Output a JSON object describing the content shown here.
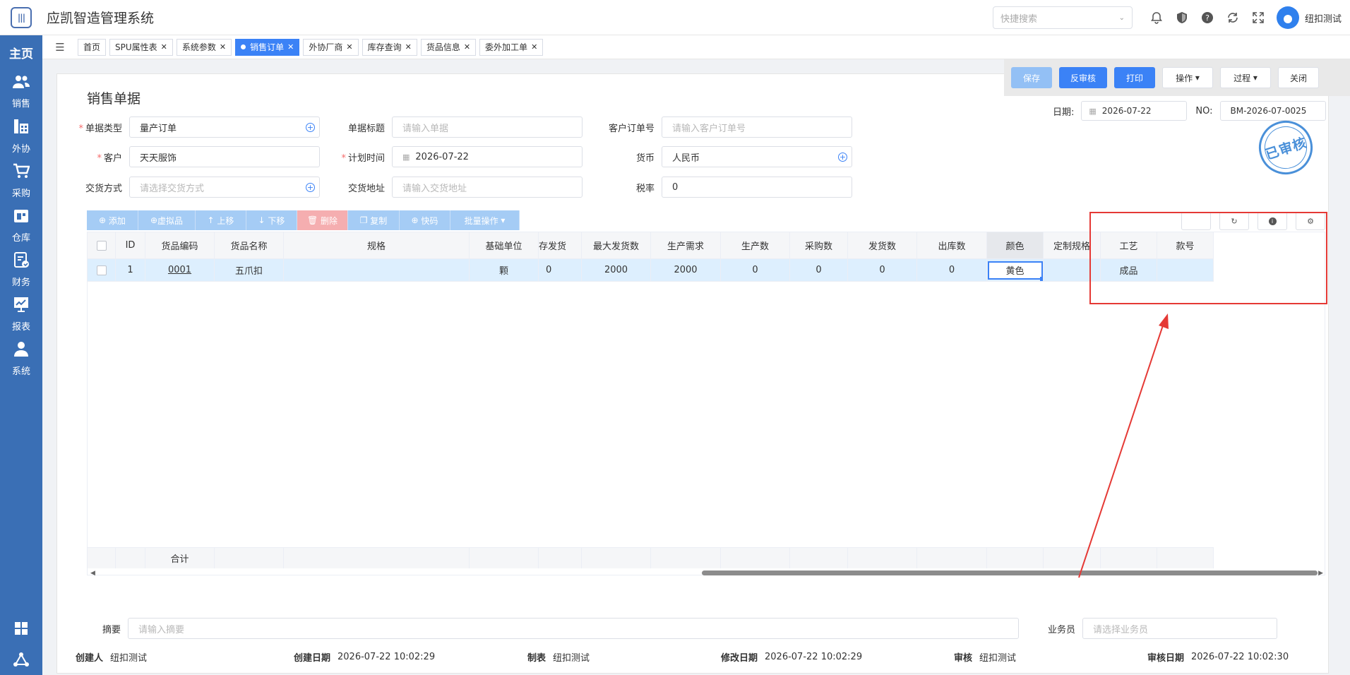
{
  "app": {
    "title": "应凯智造管理系统"
  },
  "header": {
    "search_placeholder": "快捷搜索",
    "user_name": "纽扣测试",
    "icons": [
      "bell-icon",
      "shield-icon",
      "help-icon",
      "refresh-icon",
      "fullscreen-icon"
    ]
  },
  "sidebar": {
    "home": "主页",
    "items": [
      {
        "label": "销售",
        "icon": "users-icon"
      },
      {
        "label": "外协",
        "icon": "factory-icon"
      },
      {
        "label": "采购",
        "icon": "cart-icon"
      },
      {
        "label": "仓库",
        "icon": "warehouse-icon"
      },
      {
        "label": "财务",
        "icon": "finance-icon"
      },
      {
        "label": "报表",
        "icon": "chart-icon"
      },
      {
        "label": "系统",
        "icon": "user-icon"
      }
    ]
  },
  "tabs": [
    {
      "label": "首页",
      "closable": false
    },
    {
      "label": "SPU属性表",
      "closable": true
    },
    {
      "label": "系统参数",
      "closable": true
    },
    {
      "label": "销售订单",
      "closable": true,
      "active": true
    },
    {
      "label": "外协厂商",
      "closable": true
    },
    {
      "label": "库存查询",
      "closable": true
    },
    {
      "label": "货品信息",
      "closable": true
    },
    {
      "label": "委外加工单",
      "closable": true
    }
  ],
  "actions": {
    "save": "保存",
    "unaudit": "反审核",
    "print": "打印",
    "operate": "操作",
    "process": "过程",
    "close": "关闭"
  },
  "doc": {
    "title": "销售单据",
    "date_label": "日期:",
    "date_value": "2026-07-22",
    "no_label": "NO:",
    "no_value": "BM-2026-07-0025",
    "stamp": "已审核"
  },
  "form": {
    "doc_type_label": "单据类型",
    "doc_type_value": "量产订单",
    "doc_title_label": "单据标题",
    "doc_title_placeholder": "请输入单据",
    "cust_order_label": "客户订单号",
    "cust_order_placeholder": "请输入客户订单号",
    "customer_label": "客户",
    "customer_value": "天天服饰",
    "plan_time_label": "计划时间",
    "plan_time_value": "2026-07-22",
    "currency_label": "货币",
    "currency_value": "人民币",
    "delivery_method_label": "交货方式",
    "delivery_method_placeholder": "请选择交货方式",
    "delivery_addr_label": "交货地址",
    "delivery_addr_placeholder": "请输入交货地址",
    "tax_label": "税率",
    "tax_value": "0"
  },
  "toolbar": {
    "add": "添加",
    "virtual": "虚拟品",
    "up": "上移",
    "down": "下移",
    "delete": "删除",
    "copy": "复制",
    "quick": "快码",
    "batch": "批量操作"
  },
  "table": {
    "columns": [
      "ID",
      "货品编码",
      "货品名称",
      "规格",
      "基础单位",
      "存发货",
      "最大发货数",
      "生产需求",
      "生产数",
      "采购数",
      "发货数",
      "出库数",
      "颜色",
      "定制规格",
      "工艺",
      "款号"
    ],
    "rows": [
      {
        "id": "1",
        "code": "0001",
        "name": "五爪扣",
        "spec": "",
        "unit": "颗",
        "stock_ship": "0",
        "max_ship": "2000",
        "prod_demand": "2000",
        "produced": "0",
        "purchased": "0",
        "shipped": "0",
        "outbound": "0",
        "color": "黄色",
        "custom_spec": "",
        "craft": "成品",
        "style_no": ""
      }
    ],
    "footer_label": "合计"
  },
  "bottom": {
    "summary_label": "摘要",
    "summary_placeholder": "请输入摘要",
    "salesman_label": "业务员",
    "salesman_placeholder": "请选择业务员",
    "creator_label": "创建人",
    "creator_value": "纽扣测试",
    "created_label": "创建日期",
    "created_value": "2026-07-22 10:02:29",
    "maker_label": "制表",
    "maker_value": "纽扣测试",
    "modified_label": "修改日期",
    "modified_value": "2026-07-22 10:02:29",
    "auditor_label": "审核",
    "auditor_value": "纽扣测试",
    "audit_date_label": "审核日期",
    "audit_date_value": "2026-07-22 10:02:30"
  },
  "colors": {
    "primary": "#3b82f6",
    "sidebar": "#3a6fb5",
    "annotation": "#e53935"
  }
}
